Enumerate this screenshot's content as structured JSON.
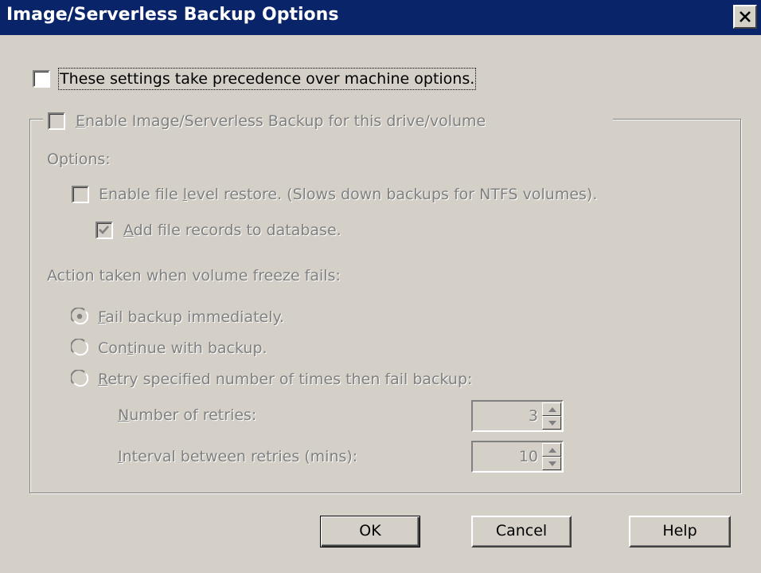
{
  "window": {
    "title": "Image/Serverless Backup Options",
    "close_label": "Close"
  },
  "precedence": {
    "label": "These settings take precedence over machine options.",
    "checked": false
  },
  "group": {
    "enable_pre": "",
    "enable_key": "E",
    "enable_post": "nable Image/Serverless Backup for this drive/volume",
    "enabled": false,
    "options_label": "Options:",
    "file_level_pre": "Enable file ",
    "file_level_key": "l",
    "file_level_post": "evel restore. (Slows down backups for NTFS volumes).",
    "add_records_key": "A",
    "add_records_post": "dd file records to database.",
    "add_records_checked": true,
    "action_label": "Action taken when volume freeze fails:",
    "radio_fail_key": "F",
    "radio_fail_post": "ail backup immediately.",
    "radio_continue_pre": "Con",
    "radio_continue_key": "t",
    "radio_continue_post": "inue with backup.",
    "radio_retry_key": "R",
    "radio_retry_post": "etry specified number of times then fail backup:",
    "selected_radio": "fail",
    "retries_key": "N",
    "retries_post": "umber of retries:",
    "retries_value": "3",
    "interval_key": "I",
    "interval_post": "nterval between retries (mins):",
    "interval_value": "10"
  },
  "buttons": {
    "ok": "OK",
    "cancel": "Cancel",
    "help": "Help"
  },
  "colors": {
    "title_bar": "#0a246a",
    "dialog_bg": "#d4d0c8",
    "disabled_text": "#808080"
  }
}
